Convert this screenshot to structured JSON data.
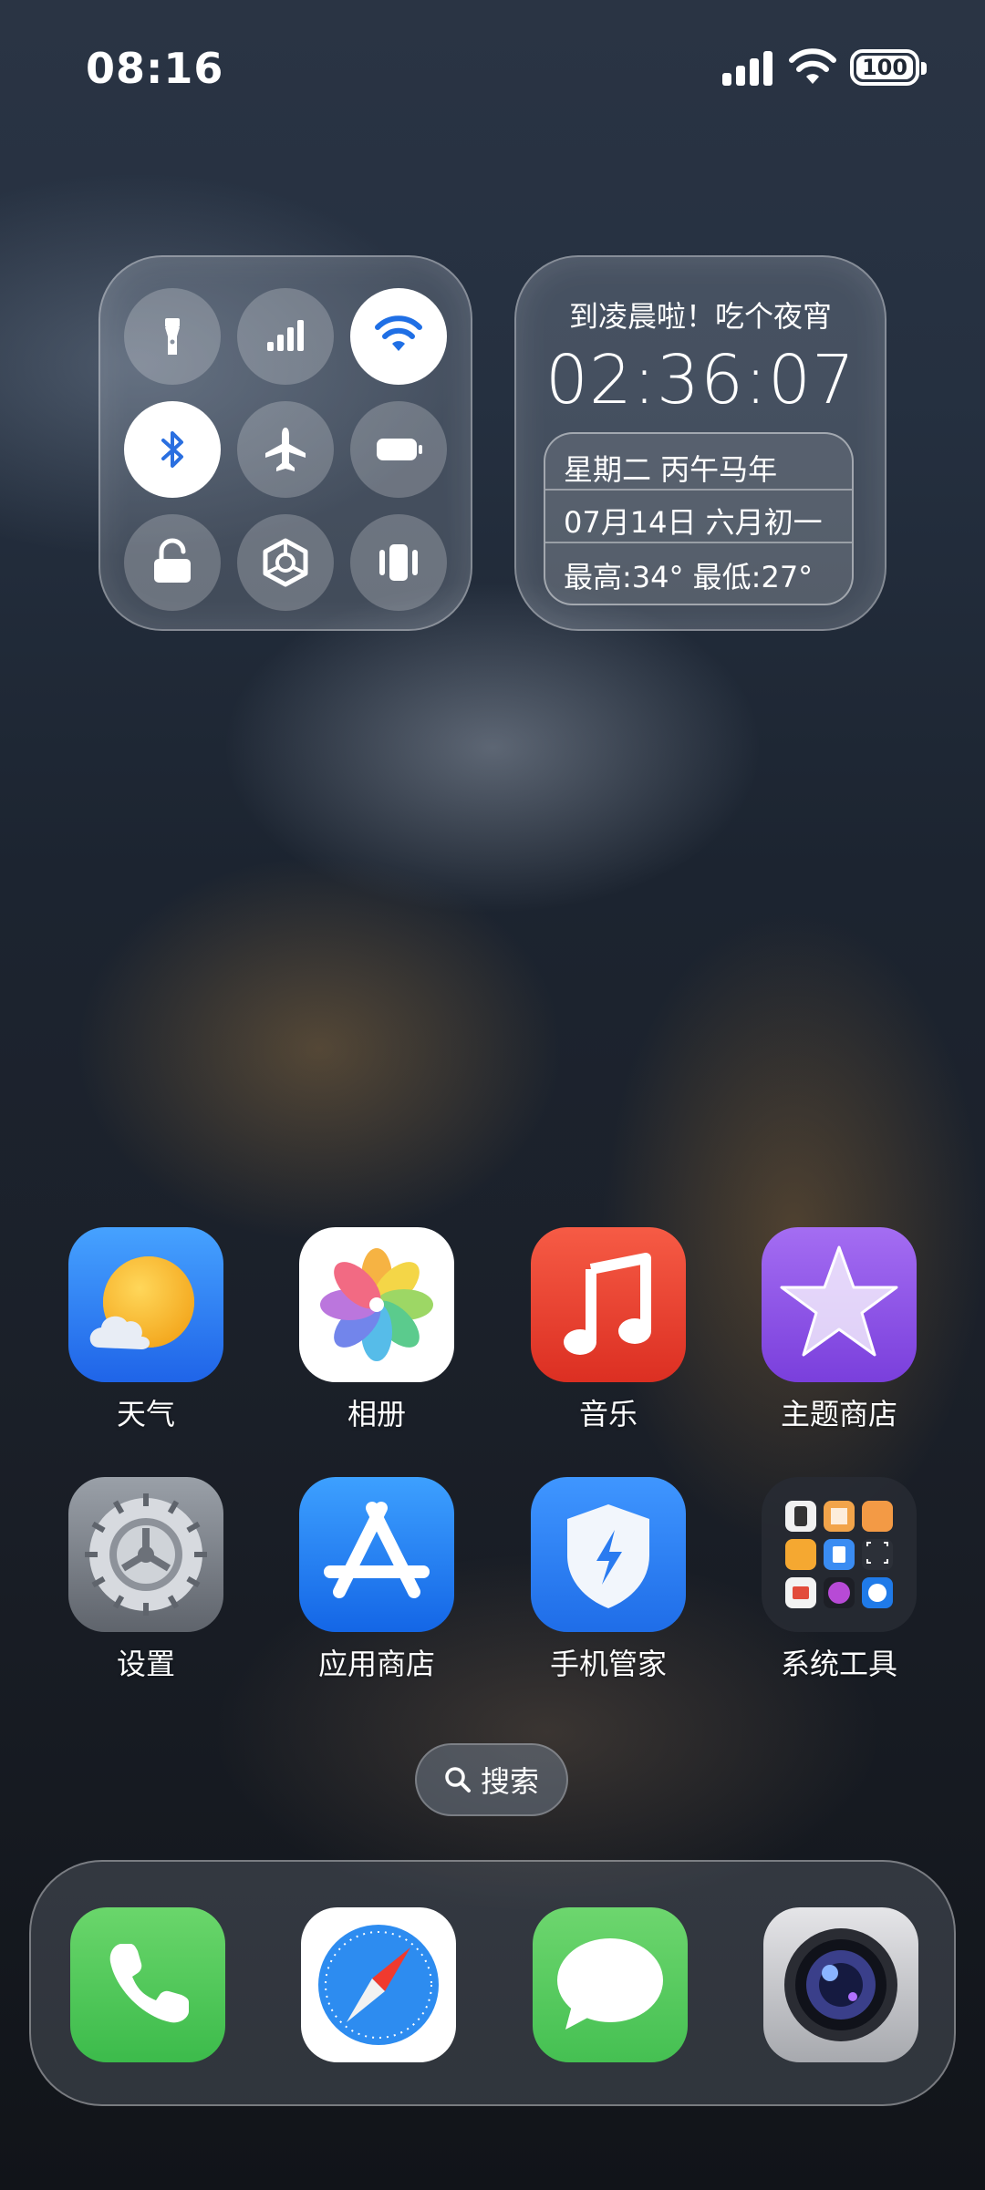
{
  "status_bar": {
    "time": "08:16",
    "battery": "100",
    "icons": [
      "signal-icon",
      "wifi-icon",
      "battery-icon"
    ]
  },
  "control_widget": {
    "buttons": [
      {
        "icon": "flashlight-icon",
        "active": false
      },
      {
        "icon": "cellular-icon",
        "active": false
      },
      {
        "icon": "wifi-icon",
        "active": true
      },
      {
        "icon": "bluetooth-icon",
        "active": true
      },
      {
        "icon": "airplane-icon",
        "active": false
      },
      {
        "icon": "battery-saver-icon",
        "active": false
      },
      {
        "icon": "rotation-lock-icon",
        "active": false
      },
      {
        "icon": "hotspot-icon",
        "active": false
      },
      {
        "icon": "vibrate-icon",
        "active": false
      }
    ]
  },
  "clock_widget": {
    "greeting": "到凌晨啦！吃个夜宵",
    "time": "02:36:07",
    "weekday": "星期二 丙午马年",
    "date": "07月14日 六月初一",
    "temperature": "最高:34° 最低:27°"
  },
  "apps": [
    {
      "label": "天气",
      "icon": "weather-icon"
    },
    {
      "label": "相册",
      "icon": "photos-icon"
    },
    {
      "label": "音乐",
      "icon": "music-icon"
    },
    {
      "label": "主题商店",
      "icon": "theme-store-icon"
    },
    {
      "label": "设置",
      "icon": "settings-icon"
    },
    {
      "label": "应用商店",
      "icon": "app-store-icon"
    },
    {
      "label": "手机管家",
      "icon": "phone-manager-icon"
    },
    {
      "label": "系统工具",
      "icon": "system-tools-folder-icon"
    }
  ],
  "search": {
    "label": "搜索"
  },
  "dock": [
    "phone-icon",
    "browser-icon",
    "messages-icon",
    "camera-icon"
  ],
  "colors": {
    "weather": "#2f7cf0",
    "music": "#e83f2e",
    "theme_store": "#8a4fe0",
    "app_store": "#1d76f0",
    "phone_manager": "#2a7bf0",
    "phone": "#46c95a",
    "messages": "#52c75e"
  }
}
